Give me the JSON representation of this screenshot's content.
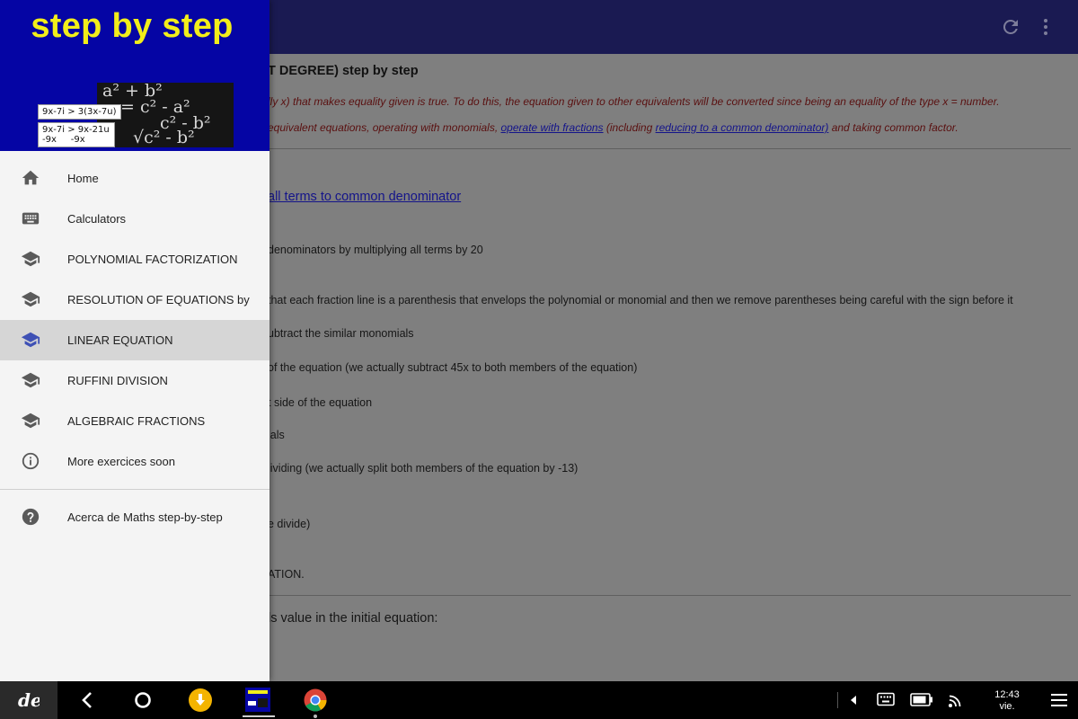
{
  "app_colors": {
    "appbar": "#1a1a52",
    "drawer_header": "#0505a4",
    "accent": "#3f51b5",
    "title_yellow": "#f2ee1a"
  },
  "appbar": {
    "actions": [
      "refresh-icon",
      "more-vert-icon"
    ]
  },
  "content": {
    "title": "T DEGREE) step by step",
    "intro_line1": "lly x) that makes equality given is true. To do this, the equation given to other equivalents will be converted since being an equality of the type x = number.",
    "intro_line2_pre": "equivalent equations, operating with monomials, ",
    "intro_link1": "operate with fractions",
    "intro_line2_mid": " (including ",
    "intro_link2": "reducing to a common denominator)",
    "intro_line2_post": " and taking common factor.",
    "step_link": " all terms to common denominator",
    "steps": [
      "denominators by multiplying all terms by 20",
      "that each fraction line is a parenthesis that envelops the polynomial or monomial and then we remove parentheses being careful with the sign before it",
      "ubtract the similar monomials",
      "of the equation (we actually subtract 45x to both members of the equation)",
      "t side of the equation",
      "ials",
      "lividing (we actually split both members of the equation by -13)",
      "e divide)",
      "ATION."
    ],
    "check_line": "ls value in the initial equation:"
  },
  "drawer": {
    "header_title": "step by step",
    "card1": "9x-7i > 3(3x-7u)",
    "card2_line1": "9x-7i > 9x-21u",
    "card2_line2": "-9x     -9x",
    "chalk": [
      "a² + b²",
      "= c² - a²",
      "c² - b²",
      "√c² - b²"
    ],
    "items": [
      {
        "label": "Home",
        "icon": "home-icon",
        "active": false
      },
      {
        "label": "Calculators",
        "icon": "keyboard-icon",
        "active": false
      },
      {
        "label": "POLYNOMIAL FACTORIZATION",
        "icon": "school-icon",
        "active": false
      },
      {
        "label": "RESOLUTION OF EQUATIONS by",
        "icon": "school-icon",
        "active": false
      },
      {
        "label": "LINEAR EQUATION",
        "icon": "school-icon",
        "active": true
      },
      {
        "label": "RUFFINI DIVISION",
        "icon": "school-icon",
        "active": false
      },
      {
        "label": "ALGEBRAIC FRACTIONS",
        "icon": "school-icon",
        "active": false
      },
      {
        "label": "More exercices soon",
        "icon": "info-icon",
        "active": false
      }
    ],
    "footer_item": {
      "label": "Acerca de Maths step-by-step",
      "icon": "help-icon"
    }
  },
  "sysbar": {
    "time": "12:43",
    "day": "vie.",
    "left_icons": [
      "launcher-icon",
      "back-icon",
      "home-circle-icon",
      "download-app-icon",
      "maths-app-icon",
      "chrome-icon"
    ],
    "right_icons": [
      "caret-left-icon",
      "keyboard-icon",
      "battery-icon",
      "cast-icon",
      "menu-icon"
    ]
  }
}
